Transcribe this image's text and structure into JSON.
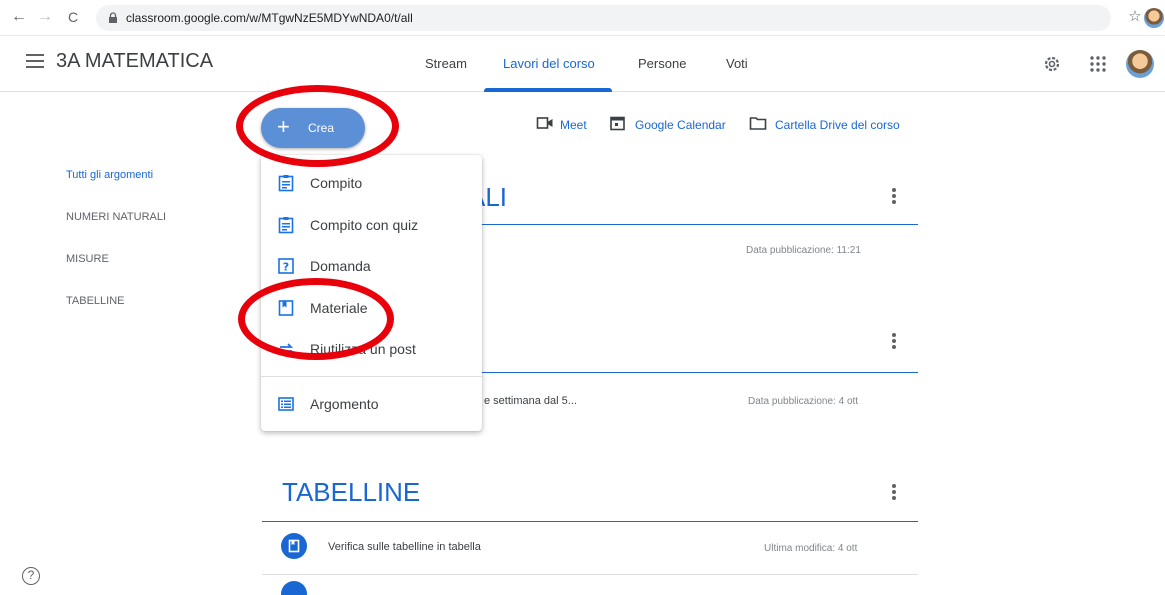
{
  "browser": {
    "url": "classroom.google.com/w/MTgwNzE5MDYwNDA0/t/all",
    "back": "←",
    "forward": "→",
    "reload": "C",
    "star": "☆"
  },
  "header": {
    "class_title": "3A MATEMATICA",
    "tabs": [
      {
        "label": "Stream"
      },
      {
        "label": "Lavori del corso"
      },
      {
        "label": "Persone"
      },
      {
        "label": "Voti"
      }
    ]
  },
  "topics_nav": {
    "items": [
      {
        "label": "Tutti gli argomenti"
      },
      {
        "label": "NUMERI NATURALI"
      },
      {
        "label": "MISURE"
      },
      {
        "label": "TABELLINE"
      }
    ]
  },
  "quick_links": {
    "meet": "Meet",
    "calendar": "Google Calendar",
    "drive": "Cartella Drive del corso"
  },
  "create": {
    "plus": "+",
    "label": "Crea"
  },
  "create_menu": {
    "items": [
      {
        "label": "Compito",
        "icon": "assignment-icon"
      },
      {
        "label": "Compito con quiz",
        "icon": "quiz-assignment-icon"
      },
      {
        "label": "Domanda",
        "icon": "question-icon"
      },
      {
        "label": "Materiale",
        "icon": "material-icon"
      },
      {
        "label": "Riutilizza un post",
        "icon": "reuse-icon"
      },
      {
        "label": "Argomento",
        "icon": "topic-icon"
      }
    ]
  },
  "sections": [
    {
      "title_visible": "ALI",
      "item_date": "Data pubblicazione: 11:21"
    },
    {
      "item_text": "e settimana dal 5...",
      "item_date": "Data pubblicazione: 4 ott"
    },
    {
      "title": "TABELLINE",
      "item_text": "Verifica sulle tabelline in tabella",
      "item_date": "Ultima modifica: 4 ott"
    }
  ],
  "help": "?",
  "colors": {
    "accent": "#1967d2",
    "create_button": "#5b8fd6",
    "annotation": "#e8000b"
  }
}
